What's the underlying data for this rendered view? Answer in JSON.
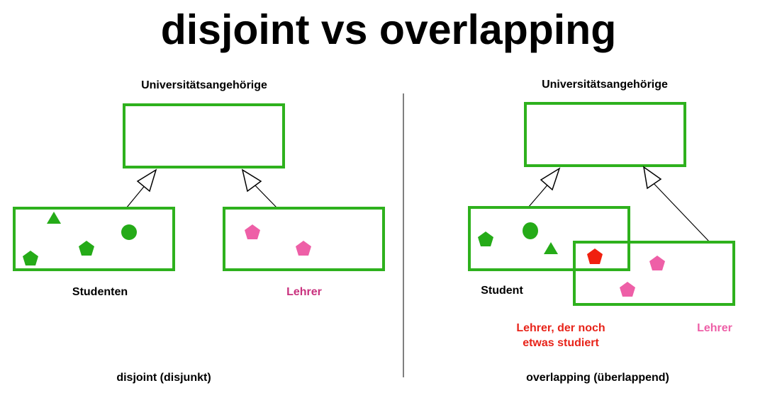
{
  "title": "disjoint vs overlapping",
  "colors": {
    "box": "#2eb11d",
    "green_shape": "#25ab18",
    "pink_shape": "#ee5fa7",
    "red_shape": "#f0200f",
    "lehrer_disjoint": "#c9317e",
    "lehrer_overlap": "#ee5fa7",
    "overlap_label": "#e8241a",
    "line": "#000000"
  },
  "left": {
    "superclass_label": "Universitätsangehörige",
    "sub1_label": "Studenten",
    "sub2_label": "Lehrer",
    "caption": "disjoint (disjunkt)"
  },
  "right": {
    "superclass_label": "Universitätsangehörige",
    "sub1_label": "Student",
    "sub2_label": "Lehrer",
    "overlap_label_line1": "Lehrer, der noch",
    "overlap_label_line2": "etwas studiert",
    "caption": "overlapping (überlappend)"
  }
}
